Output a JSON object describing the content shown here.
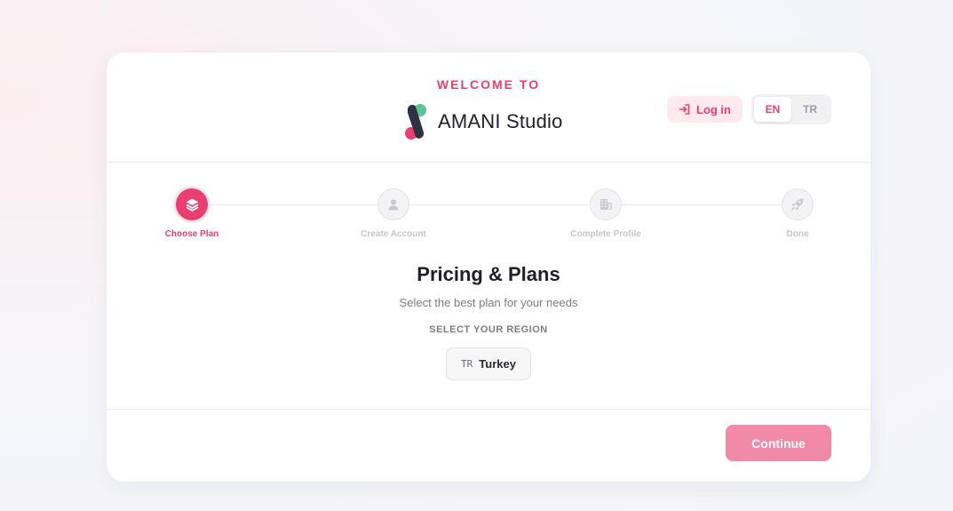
{
  "header": {
    "welcome": "WELCOME TO",
    "brand_name": "AMANI Studio",
    "login_label": "Log in",
    "languages": [
      {
        "code": "EN",
        "active": true
      },
      {
        "code": "TR",
        "active": false
      }
    ]
  },
  "stepper": {
    "steps": [
      {
        "label": "Choose Plan",
        "icon": "layers-icon",
        "active": true
      },
      {
        "label": "Create Account",
        "icon": "user-icon",
        "active": false
      },
      {
        "label": "Complete Profile",
        "icon": "building-icon",
        "active": false
      },
      {
        "label": "Done",
        "icon": "rocket-icon",
        "active": false
      }
    ]
  },
  "main": {
    "title": "Pricing & Plans",
    "subtitle": "Select the best plan for your needs",
    "region_label": "SELECT YOUR REGION",
    "region": {
      "code": "TR",
      "name": "Turkey"
    }
  },
  "footer": {
    "continue_label": "Continue"
  },
  "colors": {
    "accent": "#e83e70",
    "accent_soft": "#fde9ee",
    "continue_disabled": "#f08aa7",
    "logo_green": "#5dc495",
    "logo_dark": "#2d3142"
  }
}
